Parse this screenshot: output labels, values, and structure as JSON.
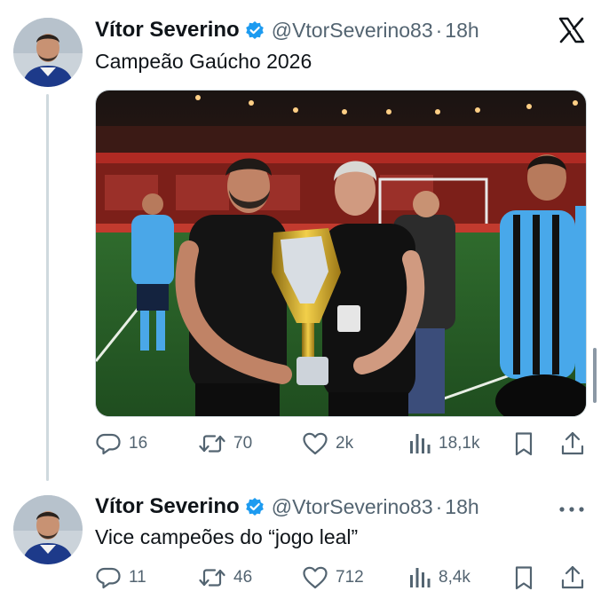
{
  "tweets": [
    {
      "author_name": "Vítor Severino",
      "handle": "@VtorSeverino83",
      "separator": "·",
      "time": "18h",
      "text": "Campeão Gaúcho 2026",
      "stats": {
        "replies": "16",
        "retweets": "70",
        "likes": "2k",
        "views": "18,1k"
      }
    },
    {
      "author_name": "Vítor Severino",
      "handle": "@VtorSeverino83",
      "separator": "·",
      "time": "18h",
      "text": "Vice campeões do “jogo leal”",
      "stats": {
        "replies": "11",
        "retweets": "46",
        "likes": "712",
        "views": "8,4k"
      }
    }
  ],
  "icons": {
    "verified": "verified-badge-icon",
    "logo": "x-logo-icon",
    "more": "more-options-icon",
    "reply": "reply-icon",
    "retweet": "retweet-icon",
    "like": "like-icon",
    "views": "views-icon",
    "bookmark": "bookmark-icon",
    "share": "share-icon"
  },
  "colors": {
    "text_primary": "#0f1419",
    "text_secondary": "#536471",
    "verified": "#1d9bf0",
    "thread_line": "#cfd9de",
    "background": "#ffffff"
  }
}
